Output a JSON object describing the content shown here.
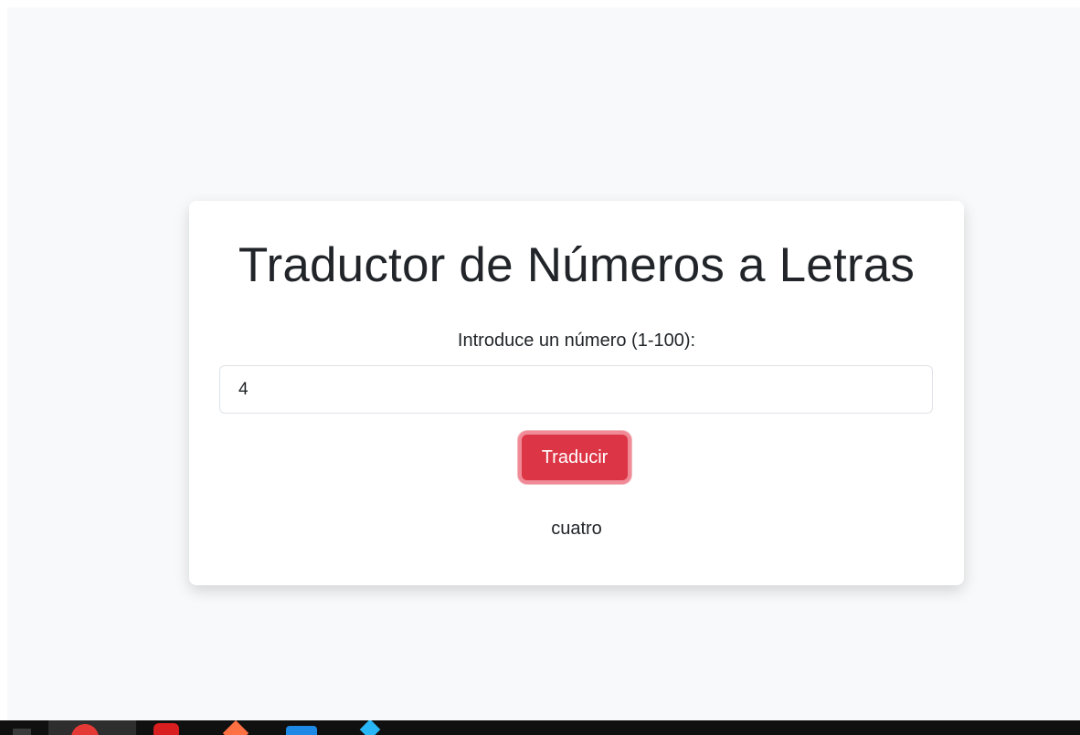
{
  "app": {
    "title": "Traductor de Números a Letras",
    "input_label": "Introduce un número (1-100):",
    "input_value": "4",
    "button_label": "Traducir",
    "result_text": "cuatro"
  },
  "colors": {
    "page_background": "#f8f9fa",
    "card_background": "#ffffff",
    "button_background": "#dc3545",
    "button_focus_ring": "#f08a96",
    "text": "#212529",
    "taskbar": "#101010"
  },
  "taskbar": {
    "icons": [
      "start-icon",
      "chrome-icon",
      "red-app-icon",
      "pen-app-icon",
      "blue-app-icon",
      "teal-app-icon"
    ]
  }
}
